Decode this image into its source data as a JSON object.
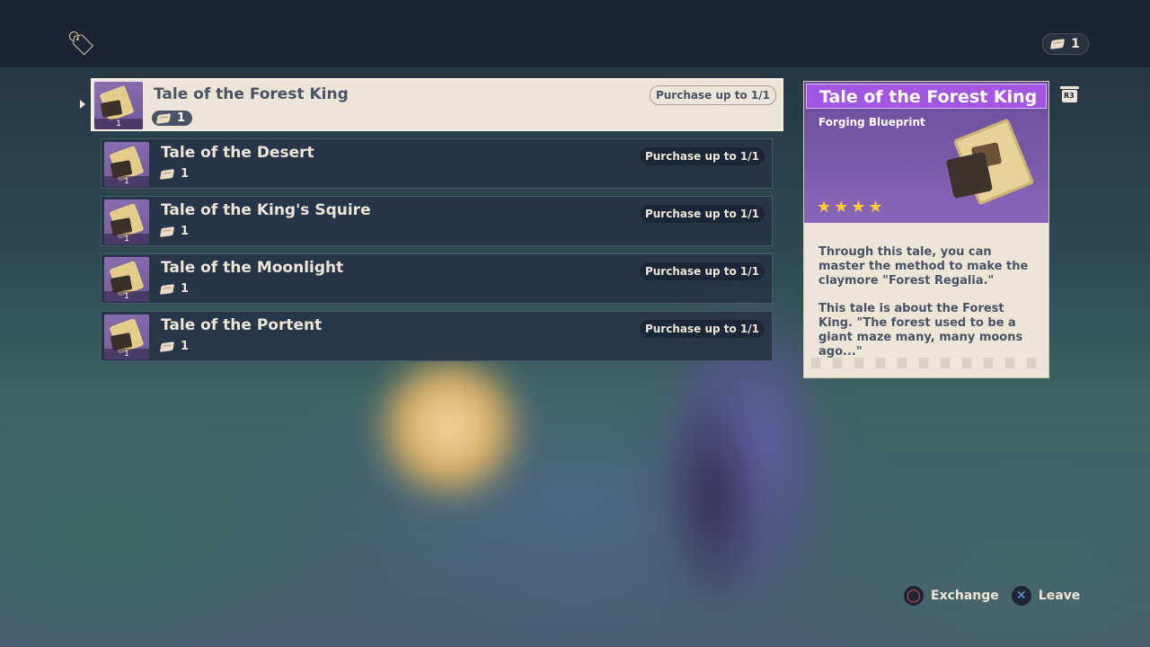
{
  "top_bar": {
    "shop_icon": "price-tag-icon",
    "currency": {
      "icon": "scroll-icon",
      "amount": "1"
    }
  },
  "shop_items": [
    {
      "name": "Tale of the Forest King",
      "price": "1",
      "limit": "Purchase up to 1/1",
      "thumb_qty": "1",
      "selected": true
    },
    {
      "name": "Tale of the Desert",
      "price": "1",
      "limit": "Purchase up to 1/1",
      "thumb_qty": "1",
      "selected": false
    },
    {
      "name": "Tale of the King's Squire",
      "price": "1",
      "limit": "Purchase up to 1/1",
      "thumb_qty": "1",
      "selected": false
    },
    {
      "name": "Tale of the Moonlight",
      "price": "1",
      "limit": "Purchase up to 1/1",
      "thumb_qty": "1",
      "selected": false
    },
    {
      "name": "Tale of the Portent",
      "price": "1",
      "limit": "Purchase up to 1/1",
      "thumb_qty": "1",
      "selected": false
    }
  ],
  "detail": {
    "name": "Tale of the Forest King",
    "type": "Forging Blueprint",
    "rarity": 4,
    "description_1": "Through this tale, you can master the method to make the claymore \"Forest Regalia.\"",
    "description_2": "This tale is about the Forest King. \"The forest used to be a giant maze many, many moons ago...\"",
    "colors": {
      "name_bar": "#a256e1",
      "header_bg": "#7a59aa",
      "card_bg": "#ece5d8"
    },
    "r3_label": "R3"
  },
  "hints": [
    {
      "button": "circle-button-icon",
      "label": "Exchange"
    },
    {
      "button": "cross-button-icon",
      "label": "Leave"
    }
  ]
}
